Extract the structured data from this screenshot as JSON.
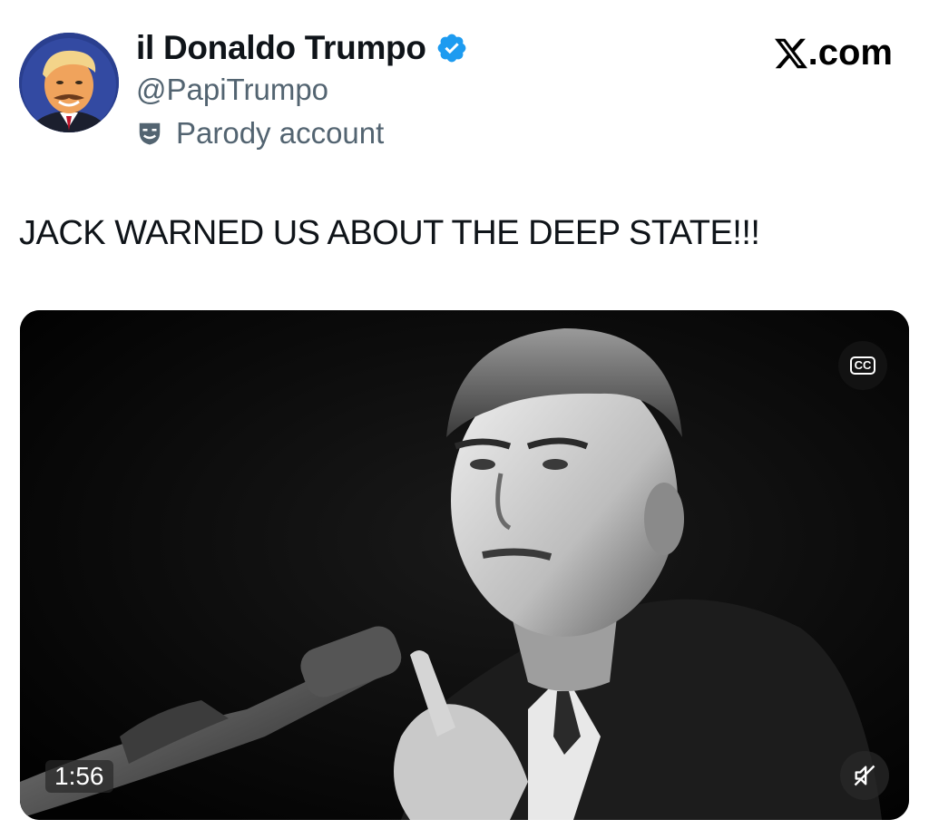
{
  "author": {
    "display_name": "il Donaldo Trumpo",
    "handle": "@PapiTrumpo",
    "label": "Parody account",
    "avatar_icon": "avatar-photo",
    "verified_icon": "verified-badge-icon",
    "verified_color": "#1d9bf0"
  },
  "brand": {
    "text": ".com",
    "logo_icon": "x-logo-icon"
  },
  "tweet": {
    "text": "JACK WARNED US ABOUT THE DEEP STATE!!!"
  },
  "video": {
    "duration": "1:56",
    "cc_label": "CC",
    "cc_icon": "closed-captions-icon",
    "mute_icon": "muted-speaker-icon"
  }
}
